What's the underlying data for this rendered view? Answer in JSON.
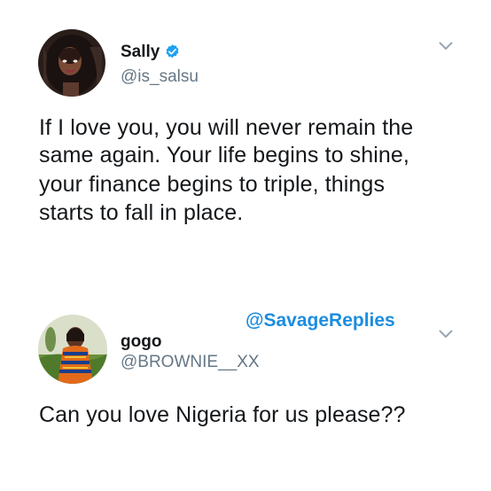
{
  "tweet1": {
    "name": "Sally",
    "handle": "@is_salsu",
    "verified": true,
    "text_lines": [
      "If I love you, you will never remain the",
      "same again. Your life begins to shine,",
      "your finance begins to triple, things",
      "starts to fall in place."
    ],
    "menu_icon": "chevron-down-icon"
  },
  "watermark": "@SavageReplies",
  "tweet2": {
    "name": "gogo",
    "handle": "@BROWNIE__XX",
    "text": "Can you love Nigeria for us please??",
    "menu_icon": "chevron-down-icon"
  },
  "colors": {
    "text": "#14171a",
    "secondary": "#657786",
    "verified_blue": "#1da1f2",
    "watermark_blue": "#1b8de0"
  }
}
